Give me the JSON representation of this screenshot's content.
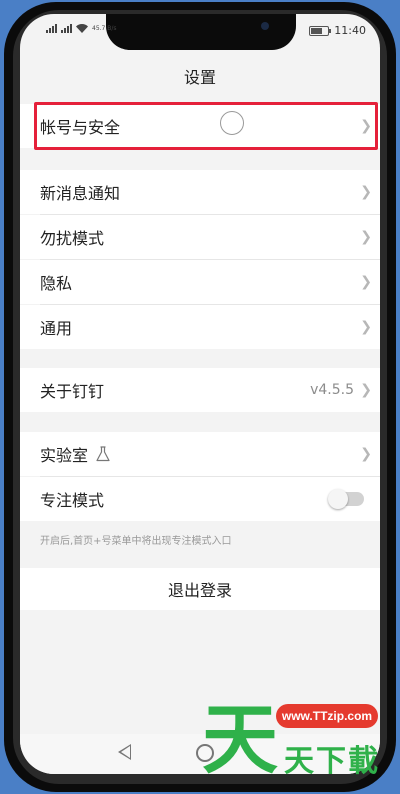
{
  "status_bar": {
    "network_speed": "45.7 B/s",
    "time": "11:40"
  },
  "page": {
    "title": "设置"
  },
  "settings": {
    "account_security": "帐号与安全",
    "new_message_notify": "新消息通知",
    "do_not_disturb": "勿扰模式",
    "privacy": "隐私",
    "general": "通用",
    "about": "关于钉钉",
    "version": "v4.5.5",
    "lab": "实验室",
    "focus_mode": "专注模式",
    "focus_mode_on": false,
    "focus_hint": "开启后,首页+号菜单中将出现专注模式入口",
    "logout": "退出登录"
  },
  "watermark": {
    "url": "www.TTzip.com",
    "big_char": "天",
    "text": "天下載"
  },
  "colors": {
    "highlight": "#e5203a",
    "watermark_green": "#2fb14a",
    "watermark_red": "#e53a2e"
  }
}
